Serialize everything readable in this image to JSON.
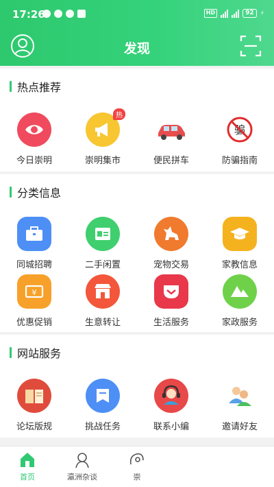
{
  "status": {
    "time": "17:26",
    "battery": "92"
  },
  "header": {
    "title": "发现"
  },
  "sections": {
    "hot": {
      "title": "热点推荐",
      "badge": "热",
      "items": [
        {
          "label": "今日崇明",
          "icon": "eye-icon",
          "color": "#f04a5e"
        },
        {
          "label": "崇明集市",
          "icon": "megaphone-icon",
          "color": "#f7c631"
        },
        {
          "label": "便民拼车",
          "icon": "car-icon",
          "color": "#e84d4d"
        },
        {
          "label": "防骗指南",
          "icon": "no-scam-icon",
          "color": "#e02b2b"
        }
      ]
    },
    "category": {
      "title": "分类信息",
      "items": [
        {
          "label": "同城招聘",
          "icon": "briefcase-icon",
          "color": "#4d8ff5"
        },
        {
          "label": "二手闲置",
          "icon": "id-card-icon",
          "color": "#3fcf6e"
        },
        {
          "label": "宠物交易",
          "icon": "dog-icon",
          "color": "#f07a2e"
        },
        {
          "label": "家教信息",
          "icon": "graduation-cap-icon",
          "color": "#f5b21f"
        },
        {
          "label": "优惠促销",
          "icon": "coupon-icon",
          "color": "#f7a12a"
        },
        {
          "label": "生意转让",
          "icon": "shop-icon",
          "color": "#f3563a"
        },
        {
          "label": "生活服务",
          "icon": "pocket-icon",
          "color": "#e8384a"
        },
        {
          "label": "家政服务",
          "icon": "mountain-icon",
          "color": "#6fd14a"
        }
      ]
    },
    "site": {
      "title": "网站服务",
      "items": [
        {
          "label": "论坛版规",
          "icon": "book-icon",
          "color": "#e04c3c"
        },
        {
          "label": "挑战任务",
          "icon": "task-icon",
          "color": "#4d8ff5"
        },
        {
          "label": "联系小编",
          "icon": "headset-icon",
          "color": "#e84848"
        },
        {
          "label": "邀请好友",
          "icon": "friends-icon",
          "color": "#5aa0e8"
        }
      ]
    }
  },
  "tabbar": {
    "tabs": [
      {
        "label": "首页",
        "icon": "home-icon",
        "active": true
      },
      {
        "label": "瀛洲杂谈",
        "icon": "chat-person-icon",
        "active": false
      },
      {
        "label": "崇",
        "icon": "profile-icon",
        "active": false
      }
    ]
  }
}
